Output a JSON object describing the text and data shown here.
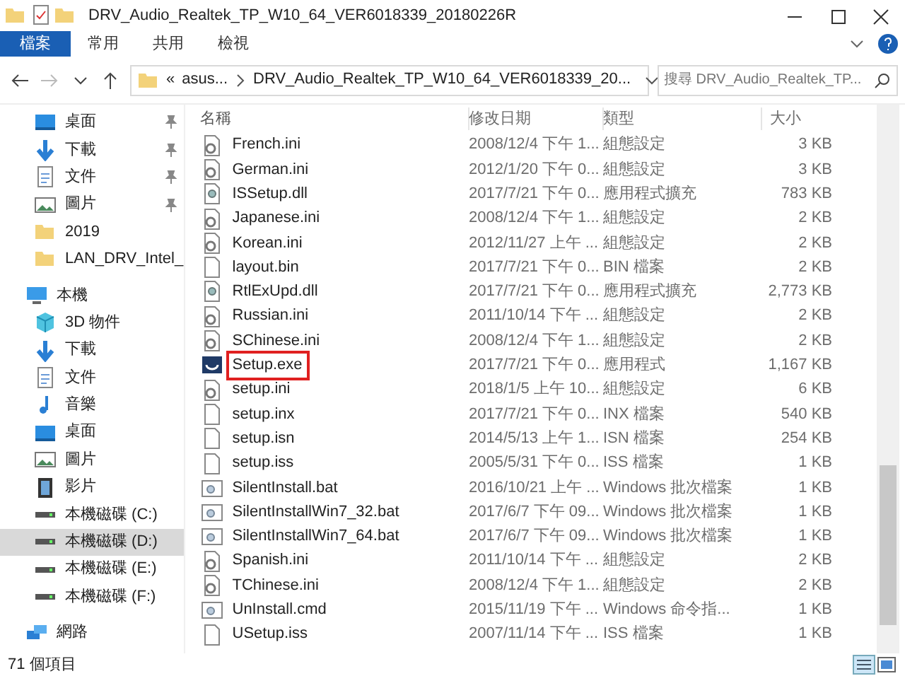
{
  "window": {
    "title": "DRV_Audio_Realtek_TP_W10_64_VER6018339_20180226R"
  },
  "ribbon_tabs": [
    {
      "label": "檔案",
      "selected": true
    },
    {
      "label": "常用",
      "selected": false
    },
    {
      "label": "共用",
      "selected": false
    },
    {
      "label": "檢視",
      "selected": false
    }
  ],
  "address": {
    "crumbs": [
      "asus...",
      "DRV_Audio_Realtek_TP_W10_64_VER6018339_20..."
    ],
    "overflow": "«"
  },
  "search": {
    "placeholder": "搜尋 DRV_Audio_Realtek_TP..."
  },
  "sidebar": {
    "items": [
      {
        "label": "桌面",
        "kind": "desktop",
        "pinned": true,
        "selected": false
      },
      {
        "label": "下載",
        "kind": "download",
        "pinned": true,
        "selected": false
      },
      {
        "label": "文件",
        "kind": "doc",
        "pinned": true,
        "selected": false
      },
      {
        "label": "圖片",
        "kind": "pictures",
        "pinned": true,
        "selected": false
      },
      {
        "label": "2019",
        "kind": "folder",
        "pinned": false,
        "selected": false
      },
      {
        "label": "LAN_DRV_Intel_",
        "kind": "folder",
        "pinned": false,
        "selected": false
      },
      {
        "label": "本機",
        "kind": "pc",
        "pinned": false,
        "selected": false
      },
      {
        "label": "3D 物件",
        "kind": "cube",
        "pinned": false,
        "selected": false
      },
      {
        "label": "下載",
        "kind": "download",
        "pinned": false,
        "selected": false
      },
      {
        "label": "文件",
        "kind": "doc",
        "pinned": false,
        "selected": false
      },
      {
        "label": "音樂",
        "kind": "music",
        "pinned": false,
        "selected": false
      },
      {
        "label": "桌面",
        "kind": "desktop",
        "pinned": false,
        "selected": false
      },
      {
        "label": "圖片",
        "kind": "pictures",
        "pinned": false,
        "selected": false
      },
      {
        "label": "影片",
        "kind": "video",
        "pinned": false,
        "selected": false
      },
      {
        "label": "本機磁碟 (C:)",
        "kind": "drive",
        "pinned": false,
        "selected": false
      },
      {
        "label": "本機磁碟 (D:)",
        "kind": "drive",
        "pinned": false,
        "selected": true
      },
      {
        "label": "本機磁碟 (E:)",
        "kind": "drive",
        "pinned": false,
        "selected": false
      },
      {
        "label": "本機磁碟 (F:)",
        "kind": "drive",
        "pinned": false,
        "selected": false
      },
      {
        "label": "網路",
        "kind": "network",
        "pinned": false,
        "selected": false
      }
    ]
  },
  "table": {
    "columns": [
      "名稱",
      "修改日期",
      "類型",
      "大小"
    ],
    "rows": [
      {
        "name": "French.ini",
        "date": "2008/12/4 下午 1...",
        "type": "組態設定",
        "size": "3 KB",
        "kind": "config",
        "highlighted": false
      },
      {
        "name": "German.ini",
        "date": "2012/1/20 下午 0...",
        "type": "組態設定",
        "size": "3 KB",
        "kind": "config",
        "highlighted": false
      },
      {
        "name": "ISSetup.dll",
        "date": "2017/7/21 下午 0...",
        "type": "應用程式擴充",
        "size": "783 KB",
        "kind": "dll",
        "highlighted": false
      },
      {
        "name": "Japanese.ini",
        "date": "2008/12/4 下午 1...",
        "type": "組態設定",
        "size": "2 KB",
        "kind": "config",
        "highlighted": false
      },
      {
        "name": "Korean.ini",
        "date": "2012/11/27 上午 ...",
        "type": "組態設定",
        "size": "2 KB",
        "kind": "config",
        "highlighted": false
      },
      {
        "name": "layout.bin",
        "date": "2017/7/21 下午 0...",
        "type": "BIN 檔案",
        "size": "2 KB",
        "kind": "blank",
        "highlighted": false
      },
      {
        "name": "RtlExUpd.dll",
        "date": "2017/7/21 下午 0...",
        "type": "應用程式擴充",
        "size": "2,773 KB",
        "kind": "dll",
        "highlighted": false
      },
      {
        "name": "Russian.ini",
        "date": "2011/10/14 下午 ...",
        "type": "組態設定",
        "size": "2 KB",
        "kind": "config",
        "highlighted": false
      },
      {
        "name": "SChinese.ini",
        "date": "2008/12/4 下午 1...",
        "type": "組態設定",
        "size": "2 KB",
        "kind": "config",
        "highlighted": false
      },
      {
        "name": "Setup.exe",
        "date": "2017/7/21 下午 0...",
        "type": "應用程式",
        "size": "1,167 KB",
        "kind": "exe",
        "highlighted": true
      },
      {
        "name": "setup.ini",
        "date": "2018/1/5 上午 10...",
        "type": "組態設定",
        "size": "6 KB",
        "kind": "config",
        "highlighted": false
      },
      {
        "name": "setup.inx",
        "date": "2017/7/21 下午 0...",
        "type": "INX 檔案",
        "size": "540 KB",
        "kind": "blank",
        "highlighted": false
      },
      {
        "name": "setup.isn",
        "date": "2014/5/13 上午 1...",
        "type": "ISN 檔案",
        "size": "254 KB",
        "kind": "blank",
        "highlighted": false
      },
      {
        "name": "setup.iss",
        "date": "2005/5/31 下午 0...",
        "type": "ISS 檔案",
        "size": "1 KB",
        "kind": "blank",
        "highlighted": false
      },
      {
        "name": "SilentInstall.bat",
        "date": "2016/10/21 上午 ...",
        "type": "Windows 批次檔案",
        "size": "1 KB",
        "kind": "bat",
        "highlighted": false
      },
      {
        "name": "SilentInstallWin7_32.bat",
        "date": "2017/6/7 下午 09...",
        "type": "Windows 批次檔案",
        "size": "1 KB",
        "kind": "bat",
        "highlighted": false
      },
      {
        "name": "SilentInstallWin7_64.bat",
        "date": "2017/6/7 下午 09...",
        "type": "Windows 批次檔案",
        "size": "1 KB",
        "kind": "bat",
        "highlighted": false
      },
      {
        "name": "Spanish.ini",
        "date": "2011/10/14 下午 ...",
        "type": "組態設定",
        "size": "2 KB",
        "kind": "config",
        "highlighted": false
      },
      {
        "name": "TChinese.ini",
        "date": "2008/12/4 下午 1...",
        "type": "組態設定",
        "size": "2 KB",
        "kind": "config",
        "highlighted": false
      },
      {
        "name": "UnInstall.cmd",
        "date": "2015/11/19 下午 ...",
        "type": "Windows 命令指...",
        "size": "1 KB",
        "kind": "bat",
        "highlighted": false
      },
      {
        "name": "USetup.iss",
        "date": "2007/11/14 下午 ...",
        "type": "ISS 檔案",
        "size": "1 KB",
        "kind": "blank",
        "highlighted": false
      }
    ]
  },
  "status_bar": {
    "count": "71 個項目"
  }
}
